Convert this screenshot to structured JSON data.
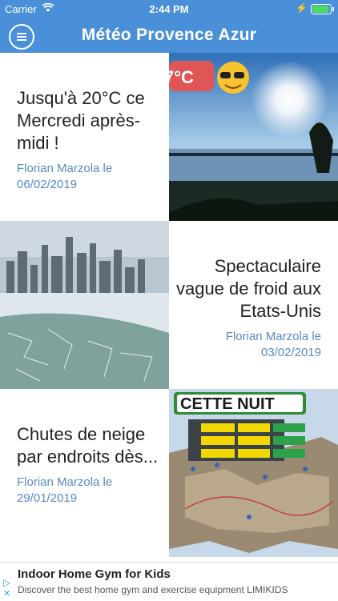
{
  "status": {
    "carrier": "Carrier",
    "time": "2:44 PM"
  },
  "header": {
    "title": "Météo Provence Azur"
  },
  "articles": [
    {
      "headline": "Jusqu'à 20°C ce Mercredi après-midi !",
      "meta": "Florian Marzola le 06/02/2019",
      "image_overlay": "7°C"
    },
    {
      "headline": "Spectaculaire vague de froid aux Etats-Unis",
      "meta": "Florian Marzola le 03/02/2019"
    },
    {
      "headline": "Chutes de neige par endroits dès...",
      "meta": "Florian Marzola le 29/01/2019",
      "image_overlay": "CETTE NUIT"
    }
  ],
  "ad": {
    "title": "Indoor Home Gym for Kids",
    "subtitle": "Discover the best home gym and exercise equipment LIMIKIDS"
  }
}
